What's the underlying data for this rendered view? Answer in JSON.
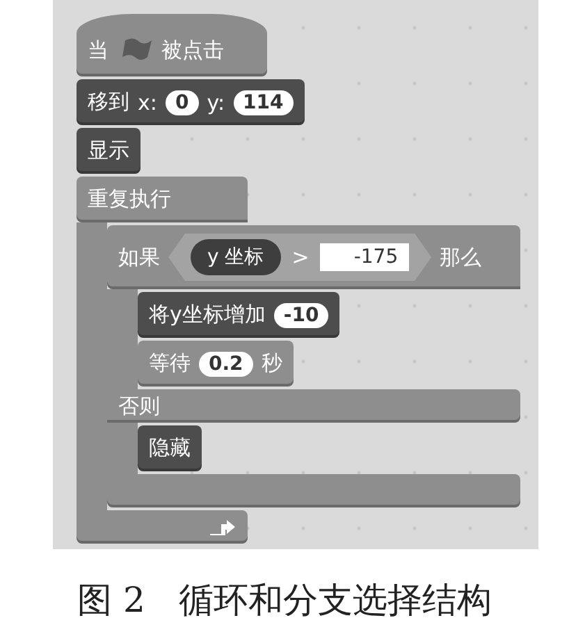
{
  "script": [
    {
      "kind": "hat",
      "color": "#8c8c8c",
      "parts": [
        {
          "kind": "label",
          "text": "当"
        },
        {
          "kind": "flag"
        },
        {
          "kind": "label",
          "text": "被点击"
        }
      ]
    },
    {
      "kind": "stack",
      "color": "#4d4d4d",
      "parts": [
        {
          "kind": "label",
          "text": "移到"
        },
        {
          "kind": "label",
          "text": "x:"
        },
        {
          "kind": "number",
          "text": "0"
        },
        {
          "kind": "label",
          "text": "y:"
        },
        {
          "kind": "number",
          "text": "114"
        }
      ]
    },
    {
      "kind": "stack",
      "color": "#4d4d4d",
      "parts": [
        {
          "kind": "label",
          "text": "显示"
        }
      ]
    },
    {
      "kind": "forever",
      "color": "#8e8e8e",
      "parts": [
        {
          "kind": "label",
          "text": "重复执行"
        }
      ],
      "children": [
        {
          "kind": "if_else",
          "color": "#8e8e8e",
          "parts": [
            {
              "kind": "label",
              "text": "如果"
            },
            {
              "kind": "condition",
              "parts": [
                {
                  "kind": "reporter",
                  "text": "y 坐标"
                },
                {
                  "kind": "label",
                  "text": ">"
                },
                {
                  "kind": "input",
                  "text": "-175"
                }
              ]
            },
            {
              "kind": "label",
              "text": "那么"
            }
          ],
          "children": [
            {
              "kind": "stack",
              "color": "#4d4d4d",
              "parts": [
                {
                  "kind": "label",
                  "text": "将y坐标增加"
                },
                {
                  "kind": "number",
                  "text": "-10"
                }
              ]
            },
            {
              "kind": "stack",
              "color": "#8e8e8e",
              "parts": [
                {
                  "kind": "label",
                  "text": "等待"
                },
                {
                  "kind": "number",
                  "text": "0.2"
                },
                {
                  "kind": "label",
                  "text": "秒"
                }
              ]
            }
          ],
          "else_parts": [
            {
              "kind": "label",
              "text": "否则"
            }
          ],
          "else_children": [
            {
              "kind": "stack",
              "color": "#4d4d4d",
              "parts": [
                {
                  "kind": "label",
                  "text": "隐藏"
                }
              ]
            }
          ]
        }
      ]
    }
  ],
  "caption": {
    "number": "图 2",
    "title": "循环和分支选择结构"
  }
}
